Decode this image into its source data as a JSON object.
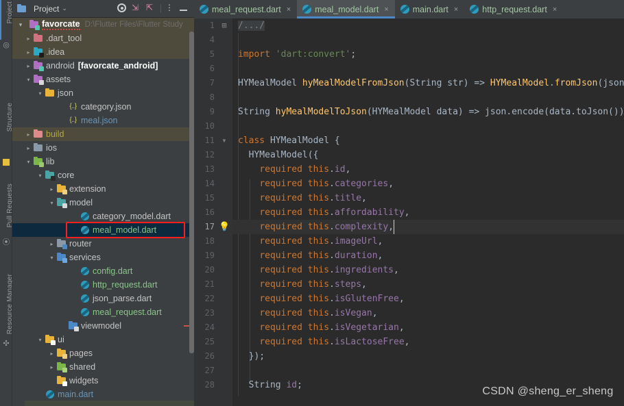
{
  "toolstrip": {
    "labels": [
      "Project",
      "Structure",
      "Pull Requests",
      "Resource Manager"
    ],
    "icons": [
      "bookmark-icon",
      "favorites-icon",
      "git-icon",
      "ant-icon"
    ]
  },
  "project_panel": {
    "title": "Project",
    "chevron": "⌄",
    "tools": [
      {
        "name": "locate-target-icon",
        "label": ""
      },
      {
        "name": "expand-all-icon",
        "label": "↙"
      },
      {
        "name": "collapse-all-icon",
        "label": "↗"
      },
      {
        "name": "more-options-icon",
        "label": "⋮"
      },
      {
        "name": "hide-panel-icon",
        "label": ""
      }
    ]
  },
  "tree": {
    "root": {
      "label": "favorcate",
      "path": "D:\\Flutter Files\\Flutter Study"
    },
    "items": [
      {
        "label": ".dart_tool",
        "depth": 2,
        "arrow": "›",
        "icon": "folder",
        "color": "#d2717f",
        "badge": "",
        "state": "sand",
        "text": "#c5c5c5"
      },
      {
        "label": ".idea",
        "depth": 2,
        "arrow": "›",
        "icon": "folder",
        "color": "#2aa8c4",
        "badge": "#1b1b1b",
        "state": "sand",
        "text": "#c5c5c5"
      },
      {
        "label": "android",
        "depth": 2,
        "arrow": "›",
        "icon": "folder",
        "color": "#b06fc4",
        "badge": "#4ec9b0",
        "state": "",
        "text": "#c5c5c5",
        "suffix": "[favorcate_android]"
      },
      {
        "label": "assets",
        "depth": 2,
        "arrow": "⌄",
        "icon": "folder",
        "color": "#b06fc4",
        "badge": "#d8d8d8",
        "state": "",
        "text": "#c5c5c5"
      },
      {
        "label": "json",
        "depth": 3,
        "arrow": "⌄",
        "icon": "folder",
        "color": "#e8b339",
        "badge": "",
        "state": "",
        "text": "#c5c5c5"
      },
      {
        "label": "category.json",
        "depth": 5,
        "arrow": "",
        "icon": "json",
        "color": "#cfcf6a",
        "badge": "",
        "state": "",
        "text": "#c5c5c5"
      },
      {
        "label": "meal.json",
        "depth": 5,
        "arrow": "",
        "icon": "json",
        "color": "#cfcf6a",
        "badge": "",
        "state": "",
        "text": "#6897bb"
      },
      {
        "label": "build",
        "depth": 2,
        "arrow": "›",
        "icon": "folder",
        "color": "#e08a8a",
        "badge": "",
        "state": "sand",
        "text": "#b5a642"
      },
      {
        "label": "ios",
        "depth": 2,
        "arrow": "›",
        "icon": "folder",
        "color": "#8a99a8",
        "badge": "",
        "state": "",
        "text": "#c5c5c5"
      },
      {
        "label": "lib",
        "depth": 2,
        "arrow": "⌄",
        "icon": "folder",
        "color": "#7ab648",
        "badge": "#9cc96b",
        "state": "",
        "text": "#c5c5c5"
      },
      {
        "label": "core",
        "depth": 3,
        "arrow": "⌄",
        "icon": "folder",
        "color": "#4ba3a3",
        "badge": "#2b2b2b",
        "state": "",
        "text": "#c5c5c5"
      },
      {
        "label": "extension",
        "depth": 4,
        "arrow": "›",
        "icon": "folder",
        "color": "#e8b339",
        "badge": "#f0d080",
        "state": "",
        "text": "#c5c5c5"
      },
      {
        "label": "model",
        "depth": 4,
        "arrow": "⌄",
        "icon": "folder",
        "color": "#4ba3a3",
        "badge": "#d8d8d8",
        "state": "",
        "text": "#c5c5c5"
      },
      {
        "label": "category_model.dart",
        "depth": 6,
        "arrow": "",
        "icon": "dart",
        "color": "#2f9bbd",
        "badge": "",
        "state": "",
        "text": "#c5c5c5"
      },
      {
        "label": "meal_model.dart",
        "depth": 6,
        "arrow": "",
        "icon": "dart",
        "color": "#2f9bbd",
        "badge": "",
        "state": "sel",
        "text": "#8bc48b"
      },
      {
        "label": "router",
        "depth": 4,
        "arrow": "›",
        "icon": "folder",
        "color": "#8a99a8",
        "badge": "#4a88c7",
        "state": "",
        "text": "#c5c5c5"
      },
      {
        "label": "services",
        "depth": 4,
        "arrow": "⌄",
        "icon": "folder",
        "color": "#4a88c7",
        "badge": "#6aa9e0",
        "state": "",
        "text": "#c5c5c5"
      },
      {
        "label": "config.dart",
        "depth": 6,
        "arrow": "",
        "icon": "dart",
        "color": "#2f9bbd",
        "badge": "",
        "state": "",
        "text": "#8bc48b"
      },
      {
        "label": "http_request.dart",
        "depth": 6,
        "arrow": "",
        "icon": "dart",
        "color": "#2f9bbd",
        "badge": "",
        "state": "",
        "text": "#8bc48b"
      },
      {
        "label": "json_parse.dart",
        "depth": 6,
        "arrow": "",
        "icon": "dart",
        "color": "#2f9bbd",
        "badge": "",
        "state": "",
        "text": "#c5c5c5"
      },
      {
        "label": "meal_request.dart",
        "depth": 6,
        "arrow": "",
        "icon": "dart",
        "color": "#2f9bbd",
        "badge": "",
        "state": "",
        "text": "#8bc48b"
      },
      {
        "label": "viewmodel",
        "depth": 5,
        "arrow": "",
        "icon": "folder",
        "color": "#4a88c7",
        "badge": "#d8d8d8",
        "state": "",
        "text": "#c5c5c5"
      },
      {
        "label": "ui",
        "depth": 3,
        "arrow": "⌄",
        "icon": "folder",
        "color": "#e8b339",
        "badge": "#ffffff",
        "state": "",
        "text": "#c5c5c5"
      },
      {
        "label": "pages",
        "depth": 4,
        "arrow": "›",
        "icon": "folder",
        "color": "#e8b339",
        "badge": "#f0d080",
        "state": "",
        "text": "#c5c5c5"
      },
      {
        "label": "shared",
        "depth": 4,
        "arrow": "›",
        "icon": "folder",
        "color": "#7ab648",
        "badge": "#a8d47a",
        "state": "",
        "text": "#c5c5c5"
      },
      {
        "label": "widgets",
        "depth": 4,
        "arrow": "",
        "icon": "folder",
        "color": "#e8b339",
        "badge": "#ffffff",
        "state": "",
        "text": "#c5c5c5"
      },
      {
        "label": "main.dart",
        "depth": 3,
        "arrow": "",
        "icon": "dart",
        "color": "#2f9bbd",
        "badge": "",
        "state": "",
        "text": "#6897bb"
      }
    ],
    "highlight_item": "meal_model.dart"
  },
  "tabs": [
    {
      "label": "meal_request.dart",
      "active": false,
      "close": "×"
    },
    {
      "label": "meal_model.dart",
      "active": true,
      "close": "×"
    },
    {
      "label": "main.dart",
      "active": false,
      "close": "×"
    },
    {
      "label": "http_request.dart",
      "active": false,
      "close": "×"
    }
  ],
  "editor": {
    "current_line": 17,
    "gutter_icons": {
      "line_1": "expand-fold-icon",
      "line_11": "collapse-fold-icon",
      "line_17": "intention-bulb-icon"
    },
    "lines": [
      {
        "n": "1",
        "fold": "+",
        "tokens": [
          {
            "t": "/.../",
            "c": "cmt"
          }
        ]
      },
      {
        "n": "4",
        "tokens": []
      },
      {
        "n": "5",
        "tokens": [
          {
            "t": "import ",
            "c": "kw"
          },
          {
            "t": "'dart:convert'",
            "c": "str"
          },
          {
            "t": ";",
            "c": "pln"
          }
        ]
      },
      {
        "n": "6",
        "tokens": []
      },
      {
        "n": "7",
        "tokens": [
          {
            "t": "HYMealModel ",
            "c": "typ"
          },
          {
            "t": "hyMealModelFromJson",
            "c": "fn"
          },
          {
            "t": "(",
            "c": "pln"
          },
          {
            "t": "String ",
            "c": "typ"
          },
          {
            "t": "str) => ",
            "c": "pln"
          },
          {
            "t": "HYMealModel",
            "c": "fn"
          },
          {
            "t": ".",
            "c": "pln"
          },
          {
            "t": "fromJson",
            "c": "fn"
          },
          {
            "t": "(json",
            "c": "pln"
          }
        ]
      },
      {
        "n": "8",
        "tokens": []
      },
      {
        "n": "9",
        "tokens": [
          {
            "t": "String ",
            "c": "typ"
          },
          {
            "t": "hyMealModelToJson",
            "c": "fn"
          },
          {
            "t": "(HYMealModel data) => json.encode(data.toJson())",
            "c": "pln"
          }
        ]
      },
      {
        "n": "10",
        "tokens": []
      },
      {
        "n": "11",
        "fold": "-",
        "tokens": [
          {
            "t": "class ",
            "c": "kw"
          },
          {
            "t": "HYMealModel ",
            "c": "typ"
          },
          {
            "t": "{",
            "c": "pln"
          }
        ]
      },
      {
        "n": "12",
        "tokens": [
          {
            "t": "  HYMealModel({",
            "c": "typ"
          }
        ]
      },
      {
        "n": "13",
        "tokens": [
          {
            "t": "    ",
            "c": "pln"
          },
          {
            "t": "required ",
            "c": "kw"
          },
          {
            "t": "this",
            "c": "kw"
          },
          {
            "t": ".",
            "c": "pln"
          },
          {
            "t": "id",
            "c": "fld"
          },
          {
            "t": ",",
            "c": "pln"
          }
        ]
      },
      {
        "n": "14",
        "tokens": [
          {
            "t": "    ",
            "c": "pln"
          },
          {
            "t": "required ",
            "c": "kw"
          },
          {
            "t": "this",
            "c": "kw"
          },
          {
            "t": ".",
            "c": "pln"
          },
          {
            "t": "categories",
            "c": "fld"
          },
          {
            "t": ",",
            "c": "pln"
          }
        ]
      },
      {
        "n": "15",
        "tokens": [
          {
            "t": "    ",
            "c": "pln"
          },
          {
            "t": "required ",
            "c": "kw"
          },
          {
            "t": "this",
            "c": "kw"
          },
          {
            "t": ".",
            "c": "pln"
          },
          {
            "t": "title",
            "c": "fld"
          },
          {
            "t": ",",
            "c": "pln"
          }
        ]
      },
      {
        "n": "16",
        "tokens": [
          {
            "t": "    ",
            "c": "pln"
          },
          {
            "t": "required ",
            "c": "kw"
          },
          {
            "t": "this",
            "c": "kw"
          },
          {
            "t": ".",
            "c": "pln"
          },
          {
            "t": "affordability",
            "c": "fld"
          },
          {
            "t": ",",
            "c": "pln"
          }
        ]
      },
      {
        "n": "17",
        "cur": true,
        "caret": true,
        "tokens": [
          {
            "t": "    ",
            "c": "pln"
          },
          {
            "t": "required ",
            "c": "kw"
          },
          {
            "t": "this",
            "c": "kw"
          },
          {
            "t": ".",
            "c": "pln"
          },
          {
            "t": "complexity",
            "c": "fld"
          },
          {
            "t": ",",
            "c": "pln"
          }
        ]
      },
      {
        "n": "18",
        "tokens": [
          {
            "t": "    ",
            "c": "pln"
          },
          {
            "t": "required ",
            "c": "kw"
          },
          {
            "t": "this",
            "c": "kw"
          },
          {
            "t": ".",
            "c": "pln"
          },
          {
            "t": "imageUrl",
            "c": "fld"
          },
          {
            "t": ",",
            "c": "pln"
          }
        ]
      },
      {
        "n": "19",
        "tokens": [
          {
            "t": "    ",
            "c": "pln"
          },
          {
            "t": "required ",
            "c": "kw"
          },
          {
            "t": "this",
            "c": "kw"
          },
          {
            "t": ".",
            "c": "pln"
          },
          {
            "t": "duration",
            "c": "fld"
          },
          {
            "t": ",",
            "c": "pln"
          }
        ]
      },
      {
        "n": "20",
        "tokens": [
          {
            "t": "    ",
            "c": "pln"
          },
          {
            "t": "required ",
            "c": "kw"
          },
          {
            "t": "this",
            "c": "kw"
          },
          {
            "t": ".",
            "c": "pln"
          },
          {
            "t": "ingredients",
            "c": "fld"
          },
          {
            "t": ",",
            "c": "pln"
          }
        ]
      },
      {
        "n": "21",
        "tokens": [
          {
            "t": "    ",
            "c": "pln"
          },
          {
            "t": "required ",
            "c": "kw"
          },
          {
            "t": "this",
            "c": "kw"
          },
          {
            "t": ".",
            "c": "pln"
          },
          {
            "t": "steps",
            "c": "fld"
          },
          {
            "t": ",",
            "c": "pln"
          }
        ]
      },
      {
        "n": "22",
        "tokens": [
          {
            "t": "    ",
            "c": "pln"
          },
          {
            "t": "required ",
            "c": "kw"
          },
          {
            "t": "this",
            "c": "kw"
          },
          {
            "t": ".",
            "c": "pln"
          },
          {
            "t": "isGlutenFree",
            "c": "fld"
          },
          {
            "t": ",",
            "c": "pln"
          }
        ]
      },
      {
        "n": "23",
        "tokens": [
          {
            "t": "    ",
            "c": "pln"
          },
          {
            "t": "required ",
            "c": "kw"
          },
          {
            "t": "this",
            "c": "kw"
          },
          {
            "t": ".",
            "c": "pln"
          },
          {
            "t": "isVegan",
            "c": "fld"
          },
          {
            "t": ",",
            "c": "pln"
          }
        ]
      },
      {
        "n": "24",
        "tokens": [
          {
            "t": "    ",
            "c": "pln"
          },
          {
            "t": "required ",
            "c": "kw"
          },
          {
            "t": "this",
            "c": "kw"
          },
          {
            "t": ".",
            "c": "pln"
          },
          {
            "t": "isVegetarian",
            "c": "fld"
          },
          {
            "t": ",",
            "c": "pln"
          }
        ]
      },
      {
        "n": "25",
        "tokens": [
          {
            "t": "    ",
            "c": "pln"
          },
          {
            "t": "required ",
            "c": "kw"
          },
          {
            "t": "this",
            "c": "kw"
          },
          {
            "t": ".",
            "c": "pln"
          },
          {
            "t": "isLactoseFree",
            "c": "fld"
          },
          {
            "t": ",",
            "c": "pln"
          }
        ]
      },
      {
        "n": "26",
        "tokens": [
          {
            "t": "  });",
            "c": "pln"
          }
        ]
      },
      {
        "n": "27",
        "tokens": []
      },
      {
        "n": "28",
        "tokens": [
          {
            "t": "  String ",
            "c": "typ"
          },
          {
            "t": "id",
            "c": "fld"
          },
          {
            "t": ";",
            "c": "pln"
          }
        ]
      }
    ]
  },
  "watermark": "CSDN @sheng_er_sheng",
  "colors": {
    "accent": "#4a88c7",
    "selection": "#0d293e",
    "highlight_box": "#ff1d1d",
    "editor_bg": "#2b2b2b",
    "panel_bg": "#3c3f41"
  }
}
